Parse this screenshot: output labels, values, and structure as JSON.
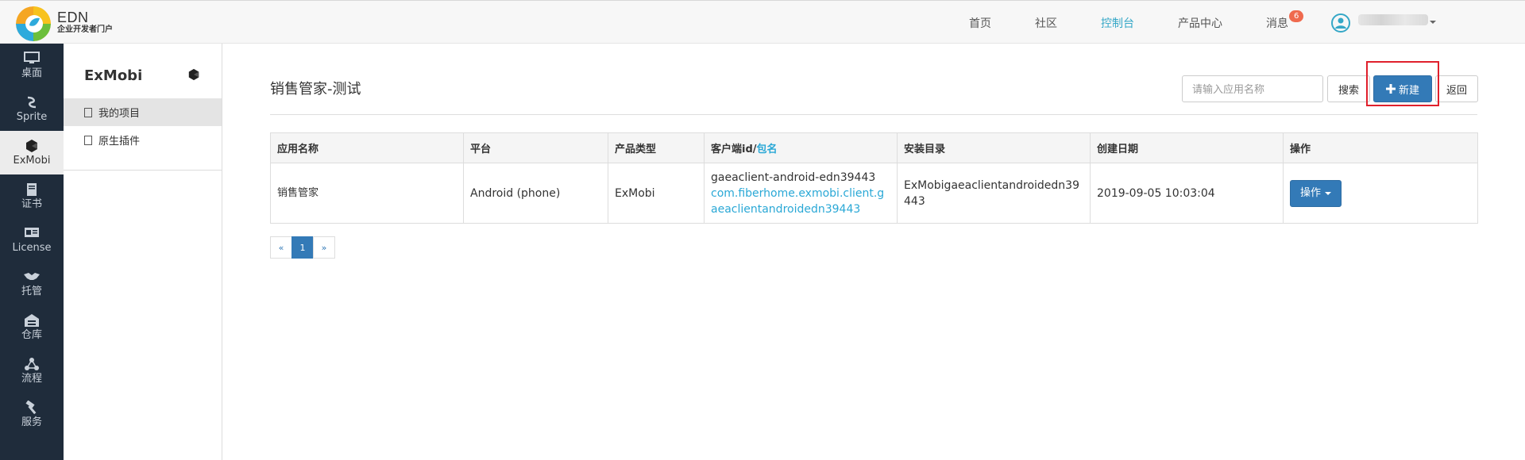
{
  "brand": {
    "title": "EDN",
    "subtitle": "企业开发者门户"
  },
  "nav": {
    "items": [
      {
        "label": "首页",
        "active": false
      },
      {
        "label": "社区",
        "active": false
      },
      {
        "label": "控制台",
        "active": true
      },
      {
        "label": "产品中心",
        "active": false
      },
      {
        "label": "消息",
        "active": false
      }
    ],
    "message_badge": "6"
  },
  "left_sidebar": {
    "items": [
      {
        "label": "桌面",
        "icon": "monitor-icon"
      },
      {
        "label": "Sprite",
        "icon": "sprite-icon"
      },
      {
        "label": "ExMobi",
        "icon": "exmobi-icon",
        "active": true
      },
      {
        "label": "证书",
        "icon": "certificate-icon"
      },
      {
        "label": "License",
        "icon": "license-icon"
      },
      {
        "label": "托管",
        "icon": "handshake-icon"
      },
      {
        "label": "仓库",
        "icon": "warehouse-icon"
      },
      {
        "label": "流程",
        "icon": "workflow-icon"
      },
      {
        "label": "服务",
        "icon": "hammer-icon"
      }
    ]
  },
  "sub_sidebar": {
    "title": "ExMobi",
    "items": [
      {
        "label": "我的项目",
        "active": true
      },
      {
        "label": "原生插件",
        "active": false
      }
    ]
  },
  "main": {
    "title": "销售管家-测试",
    "search_placeholder": "请输入应用名称",
    "search_button": "搜索",
    "new_button": "新建",
    "back_button": "返回"
  },
  "table": {
    "headers": {
      "app_name": "应用名称",
      "platform": "平台",
      "product_type": "产品类型",
      "client_id": "客户端id/",
      "client_id_link": "包名",
      "install_dir": "安装目录",
      "created": "创建日期",
      "actions": "操作"
    },
    "rows": [
      {
        "app_name": "销售管家",
        "platform": "Android (phone)",
        "product_type": "ExMobi",
        "client_id": "gaeaclient-android-edn39443",
        "package": "com.fiberhome.exmobi.client.gaeaclientandroidedn39443",
        "install_dir": "ExMobigaeaclientandroidedn39443",
        "created": "2019-09-05 10:03:04",
        "action_label": "操作"
      }
    ]
  },
  "pagination": {
    "prev": "«",
    "current": "1",
    "next": "»"
  },
  "colors": {
    "accent": "#35a7c7",
    "primary": "#337ab7",
    "sidebar": "#1f2c3b",
    "badge": "#ef6a4e",
    "highlight": "#e0202c"
  }
}
